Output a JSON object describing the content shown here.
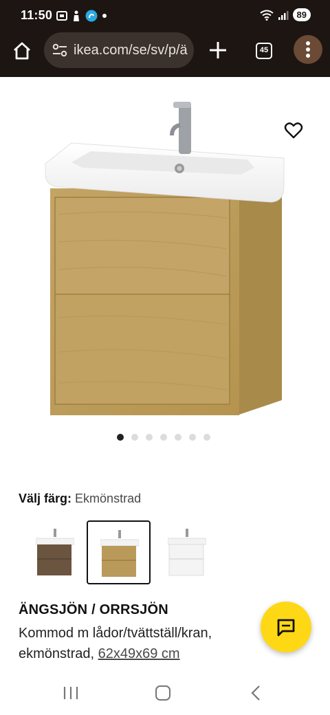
{
  "status_bar": {
    "time": "11:50",
    "battery": "89",
    "icons": [
      "screenshot-icon",
      "accessibility-icon",
      "app-notification-icon",
      "dot-icon",
      "wifi-icon",
      "signal-icon",
      "battery-icon"
    ]
  },
  "browser": {
    "url": "ikea.com/se/sv/p/ä",
    "tab_count": "45"
  },
  "gallery": {
    "image_count": 7,
    "active_index": 0
  },
  "color_select": {
    "label": "Välj färg:",
    "value": "Ekmönstrad",
    "options": [
      {
        "name": "brown-swatch",
        "colors": {
          "cabinet": "#6b5440",
          "front": "#5c4634"
        }
      },
      {
        "name": "oak-swatch",
        "colors": {
          "cabinet": "#b99a5b",
          "front": "#a9894c"
        },
        "selected": true
      },
      {
        "name": "white-swatch",
        "colors": {
          "cabinet": "#f4f4f4",
          "front": "#ebebeb"
        }
      }
    ]
  },
  "product": {
    "name": "ÄNGSJÖN / ORRSJÖN",
    "description": "Kommod m lådor/tvättställ/kran, ekmönstrad,",
    "dimensions": "62x49x69 cm"
  },
  "colors": {
    "status_bar_bg": "#1d1512",
    "chat_button": "#ffd815",
    "menu_button": "#6b4a36"
  }
}
